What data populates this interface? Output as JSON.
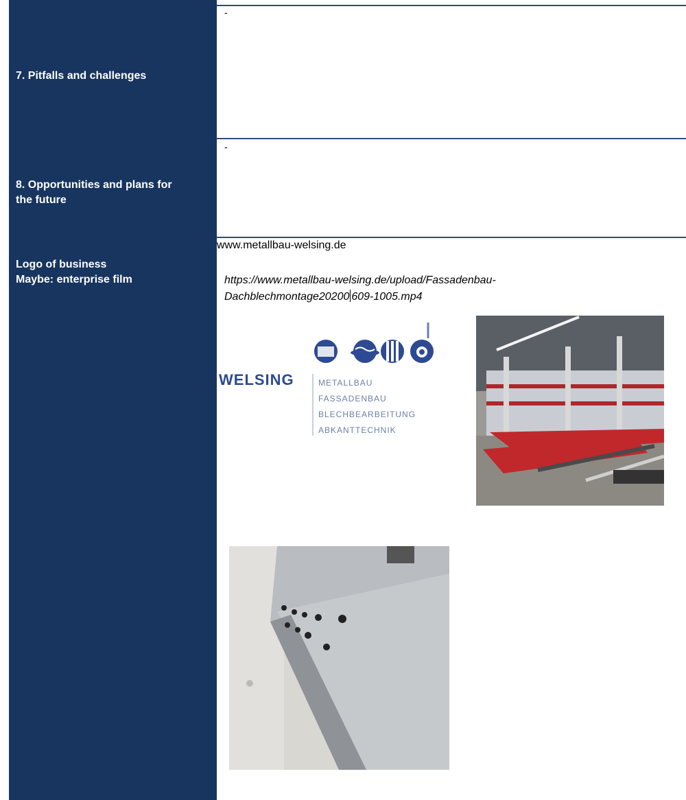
{
  "rows": {
    "pitfalls": {
      "label": "7. Pitfalls and challenges",
      "value": "-"
    },
    "opportunities": {
      "label_line1": "8. Opportunities and plans for",
      "label_line2": "the future",
      "value": "-"
    },
    "logo": {
      "label_line1": "Logo of business",
      "label_line2": "Maybe: enterprise film"
    }
  },
  "website": "www.metallbau-welsing.de",
  "film_link": {
    "line1": "https://www.metallbau-welsing.de/upload/Fassadenbau-",
    "line2_part1": "Dachblechmontage20200",
    "line2_part2": "609-1005.mp4"
  },
  "logo_image": {
    "brand": "WELSING",
    "services": [
      "METALLBAU",
      "FASSADENBAU",
      "BLECHBEARBEITUNG",
      "ABKANTTECHNIK"
    ]
  },
  "colors": {
    "sidebar": "#17355e",
    "logo_blue": "#2d4a93",
    "rule": "#2f4e72"
  }
}
